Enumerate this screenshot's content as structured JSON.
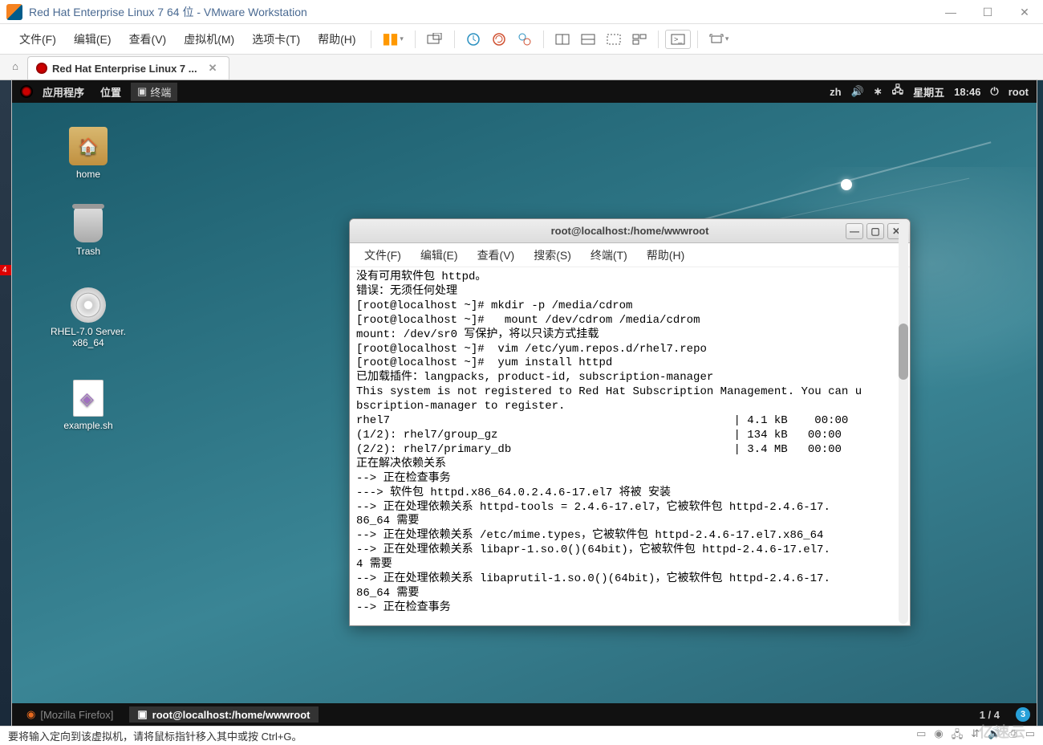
{
  "window": {
    "title": "Red Hat Enterprise Linux 7 64 位 - VMware Workstation"
  },
  "vmware_menu": {
    "items": [
      "文件(F)",
      "编辑(E)",
      "查看(V)",
      "虚拟机(M)",
      "选项卡(T)",
      "帮助(H)"
    ]
  },
  "vm_tab": {
    "label": "Red Hat Enterprise Linux 7 ..."
  },
  "gnome_panel": {
    "apps": "应用程序",
    "places": "位置",
    "terminal": "终端",
    "lang": "zh",
    "day": "星期五",
    "time": "18:46",
    "user": "root"
  },
  "desktop_icons": {
    "home": "home",
    "trash": "Trash",
    "disc": "RHEL-7.0 Server.\nx86_64",
    "file": "example.sh"
  },
  "terminal": {
    "title": "root@localhost:/home/wwwroot",
    "menu": [
      "文件(F)",
      "编辑(E)",
      "查看(V)",
      "搜索(S)",
      "终端(T)",
      "帮助(H)"
    ],
    "content": "没有可用软件包 httpd。\n错误：无须任何处理\n[root@localhost ~]# mkdir -p /media/cdrom\n[root@localhost ~]#   mount /dev/cdrom /media/cdrom\nmount: /dev/sr0 写保护，将以只读方式挂载\n[root@localhost ~]#  vim /etc/yum.repos.d/rhel7.repo\n[root@localhost ~]#  yum install httpd\n已加载插件：langpacks, product-id, subscription-manager\nThis system is not registered to Red Hat Subscription Management. You can u\nbscription-manager to register.\nrhel7                                                   | 4.1 kB    00:00\n(1/2): rhel7/group_gz                                   | 134 kB   00:00\n(2/2): rhel7/primary_db                                 | 3.4 MB   00:00\n正在解决依赖关系\n--> 正在检查事务\n---> 软件包 httpd.x86_64.0.2.4.6-17.el7 将被 安装\n--> 正在处理依赖关系 httpd-tools = 2.4.6-17.el7，它被软件包 httpd-2.4.6-17.\n86_64 需要\n--> 正在处理依赖关系 /etc/mime.types，它被软件包 httpd-2.4.6-17.el7.x86_64\n--> 正在处理依赖关系 libapr-1.so.0()(64bit)，它被软件包 httpd-2.4.6-17.el7.\n4 需要\n--> 正在处理依赖关系 libaprutil-1.so.0()(64bit)，它被软件包 httpd-2.4.6-17.\n86_64 需要\n--> 正在检查事务"
  },
  "taskbar": {
    "firefox": "[Mozilla Firefox]",
    "terminal_task": "root@localhost:/home/wwwroot",
    "workspace": "1 / 4",
    "count": "3"
  },
  "statusbar": {
    "hint": "要将输入定向到该虚拟机，请将鼠标指针移入其中或按 Ctrl+G。",
    "watermark": "亿速云"
  }
}
